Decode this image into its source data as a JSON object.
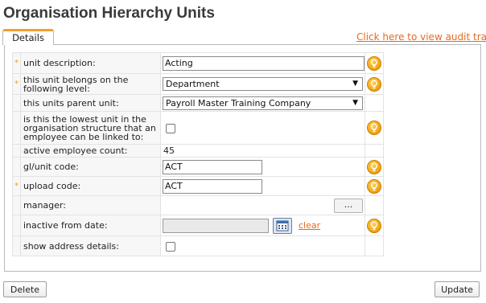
{
  "page": {
    "title": "Organisation Hierarchy Units"
  },
  "tabs": [
    {
      "label": "Details"
    }
  ],
  "audit_link": "Click here to view audit trail",
  "form": {
    "required_marker": "*",
    "rows": {
      "unit_description": {
        "label": "unit description:",
        "value": "Acting"
      },
      "belongs_to_level": {
        "label": "this unit belongs on the following level:",
        "value": "Department"
      },
      "parent_unit": {
        "label": "this units parent unit:",
        "value": "Payroll Master Training Company"
      },
      "lowest_unit": {
        "label": "is this the lowest unit in the organisation structure that an employee can be linked to:"
      },
      "active_employee_count": {
        "label": "active employee count:",
        "value": "45"
      },
      "gl_unit_code": {
        "label": "gl/unit code:",
        "value": "ACT"
      },
      "upload_code": {
        "label": "upload code:",
        "value": "ACT"
      },
      "manager": {
        "label": "manager:",
        "button": "..."
      },
      "inactive_from_date": {
        "label": "inactive from date:",
        "value": "",
        "clear": "clear"
      },
      "show_address_details": {
        "label": "show address details:"
      }
    }
  },
  "buttons": {
    "delete": "Delete",
    "update": "Update"
  },
  "colors": {
    "accent": "#e86a1a",
    "help_icon": "#f0a010",
    "tab_highlight": "#f0a030"
  },
  "icons": {
    "help": "lightbulb-help-icon",
    "calendar": "calendar-icon",
    "dropdown": "chevron-down-icon"
  }
}
